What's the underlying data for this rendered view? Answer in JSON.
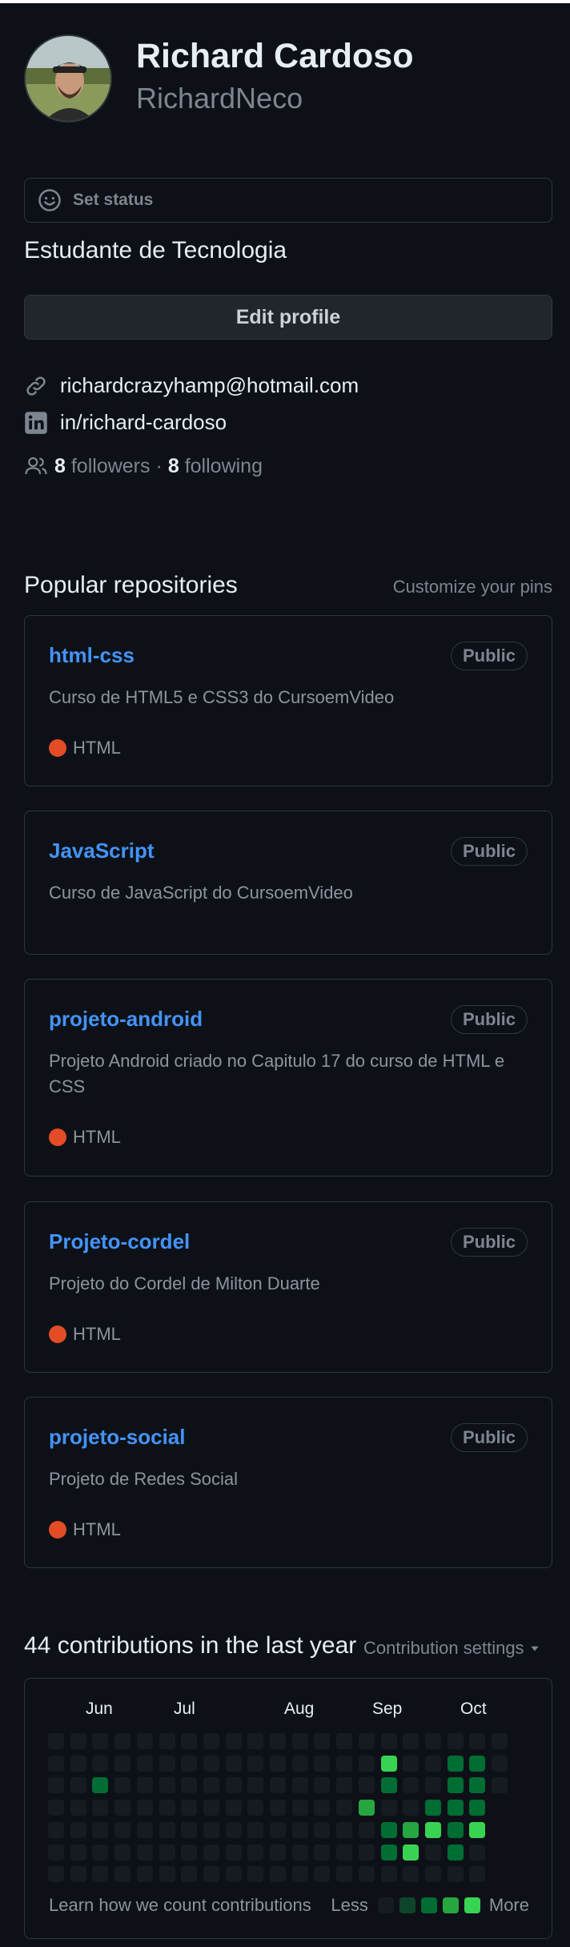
{
  "profile": {
    "name": "Richard Cardoso",
    "login": "RichardNeco",
    "set_status": "Set status",
    "bio": "Estudante de Tecnologia",
    "edit_profile": "Edit profile",
    "email": "richardcrazyhamp@hotmail.com",
    "linkedin": "in/richard-cardoso",
    "followers_count": "8",
    "followers_label": "followers",
    "separator": "·",
    "following_count": "8",
    "following_label": "following"
  },
  "popular": {
    "title": "Popular repositories",
    "customize": "Customize your pins",
    "repos": [
      {
        "name": "html-css",
        "visibility": "Public",
        "description": "Curso de HTML5 e CSS3 do CursoemVideo",
        "language": "HTML",
        "language_color": "#e34c26"
      },
      {
        "name": "JavaScript",
        "visibility": "Public",
        "description": "Curso de JavaScript do CursoemVideo",
        "language": "",
        "language_color": ""
      },
      {
        "name": "projeto-android",
        "visibility": "Public",
        "description": "Projeto Android criado no Capitulo 17 do curso de HTML e CSS",
        "language": "HTML",
        "language_color": "#e34c26"
      },
      {
        "name": "Projeto-cordel",
        "visibility": "Public",
        "description": "Projeto do Cordel de Milton Duarte",
        "language": "HTML",
        "language_color": "#e34c26"
      },
      {
        "name": "projeto-social",
        "visibility": "Public",
        "description": "Projeto de Redes Social",
        "language": "HTML",
        "language_color": "#e34c26"
      }
    ]
  },
  "contributions": {
    "title": "44 contributions in the last year",
    "settings": "Contribution settings",
    "months": [
      "Jun",
      "Jul",
      "Aug",
      "Sep",
      "Oct"
    ],
    "learn": "Learn how we count contributions",
    "less": "Less",
    "more": "More",
    "level_colors": [
      "#161b22",
      "#0e4429",
      "#006d32",
      "#26a641",
      "#39d353"
    ],
    "weeks": 21,
    "levels": [
      [
        0,
        0,
        0,
        0,
        0,
        0,
        0,
        0,
        0,
        0,
        0,
        0,
        0,
        0,
        0,
        0,
        0,
        0,
        0,
        0,
        0
      ],
      [
        0,
        0,
        0,
        0,
        0,
        0,
        0,
        0,
        0,
        0,
        0,
        0,
        0,
        0,
        0,
        4,
        0,
        0,
        2,
        2,
        0
      ],
      [
        0,
        0,
        2,
        0,
        0,
        0,
        0,
        0,
        0,
        0,
        0,
        0,
        0,
        0,
        0,
        2,
        0,
        0,
        2,
        2,
        0
      ],
      [
        0,
        0,
        0,
        0,
        0,
        0,
        0,
        0,
        0,
        0,
        0,
        0,
        0,
        0,
        3,
        0,
        0,
        2,
        2,
        2,
        null
      ],
      [
        0,
        0,
        0,
        0,
        0,
        0,
        0,
        0,
        0,
        0,
        0,
        0,
        0,
        0,
        0,
        2,
        3,
        4,
        2,
        4,
        null
      ],
      [
        0,
        0,
        0,
        0,
        0,
        0,
        0,
        0,
        0,
        0,
        0,
        0,
        0,
        0,
        0,
        2,
        4,
        0,
        2,
        0,
        null
      ],
      [
        0,
        0,
        0,
        0,
        0,
        0,
        0,
        0,
        0,
        0,
        0,
        0,
        0,
        0,
        0,
        0,
        0,
        0,
        0,
        0,
        null
      ]
    ]
  },
  "colors": {
    "accent": "#4493f8",
    "muted": "#7d8590",
    "border": "#30363d"
  },
  "icons": [
    "smiley-icon",
    "link-icon",
    "linkedin-icon",
    "people-icon",
    "triangle-down-icon"
  ]
}
